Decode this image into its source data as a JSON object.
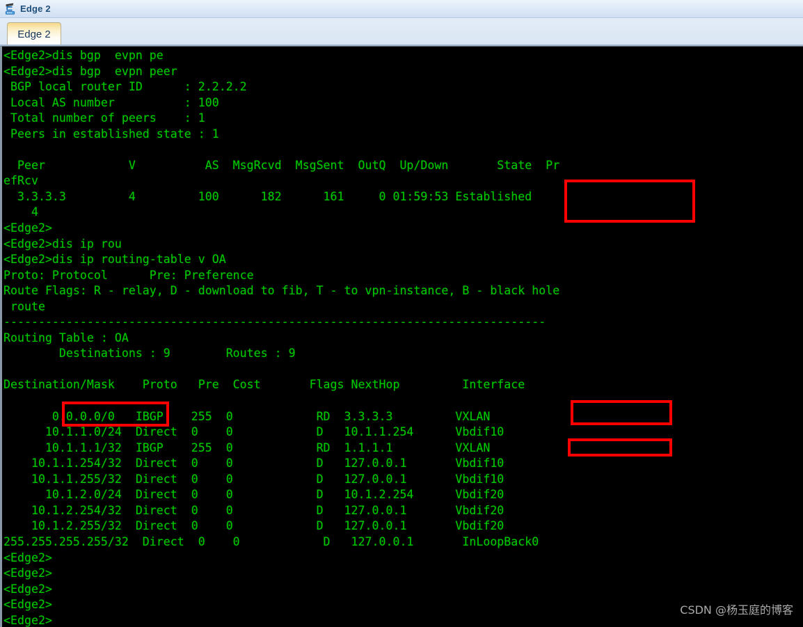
{
  "window": {
    "title": "Edge 2",
    "icon": "router-switch-icon"
  },
  "tabs": [
    {
      "label": "Edge 2",
      "active": true
    }
  ],
  "terminal": {
    "prompt": "<Edge2>",
    "foreground_color": "#00c800",
    "background_color": "#000000",
    "lines": [
      "<Edge2>dis bgp  evpn pe",
      "<Edge2>dis bgp  evpn peer",
      " BGP local router ID      : 2.2.2.2",
      " Local AS number          : 100",
      " Total number of peers    : 1",
      " Peers in established state : 1",
      "",
      "  Peer            V          AS  MsgRcvd  MsgSent  OutQ  Up/Down       State  Pr",
      "efRcv",
      "  3.3.3.3         4         100      182      161     0 01:59:53 Established",
      "    4",
      "<Edge2>",
      "<Edge2>dis ip rou",
      "<Edge2>dis ip routing-table v OA",
      "Proto: Protocol      Pre: Preference",
      "Route Flags: R - relay, D - download to fib, T - to vpn-instance, B - black hole",
      " route",
      "------------------------------------------------------------------------------",
      "Routing Table : OA",
      "        Destinations : 9        Routes : 9",
      "",
      "Destination/Mask    Proto   Pre  Cost       Flags NextHop         Interface",
      "",
      "       0.0.0.0/0   IBGP    255  0            RD  3.3.3.3         VXLAN",
      "      10.1.1.0/24  Direct  0    0            D   10.1.1.254      Vbdif10",
      "      10.1.1.1/32  IBGP    255  0            RD  1.1.1.1         VXLAN",
      "    10.1.1.254/32  Direct  0    0            D   127.0.0.1       Vbdif10",
      "    10.1.1.255/32  Direct  0    0            D   127.0.0.1       Vbdif10",
      "      10.1.2.0/24  Direct  0    0            D   10.1.2.254      Vbdif20",
      "    10.1.2.254/32  Direct  0    0            D   127.0.0.1       Vbdif20",
      "    10.1.2.255/32  Direct  0    0            D   127.0.0.1       Vbdif20",
      "255.255.255.255/32  Direct  0    0            D   127.0.0.1       InLoopBack0",
      "<Edge2>",
      "<Edge2>",
      "<Edge2>",
      "<Edge2>",
      "<Edge2>"
    ]
  },
  "bgp_summary": {
    "command": "dis bgp  evpn peer",
    "local_router_id_label": "BGP local router ID",
    "local_router_id": "2.2.2.2",
    "local_as_label": "Local AS number",
    "local_as": "100",
    "total_peers_label": "Total number of peers",
    "total_peers": "1",
    "established_peers_label": "Peers in established state",
    "established_peers": "1",
    "columns": [
      "Peer",
      "V",
      "AS",
      "MsgRcvd",
      "MsgSent",
      "OutQ",
      "Up/Down",
      "State",
      "PrefRcv"
    ],
    "rows": [
      {
        "peer": "3.3.3.3",
        "v": "4",
        "as": "100",
        "msg_rcvd": "182",
        "msg_sent": "161",
        "out_q": "0",
        "up_down": "01:59:53",
        "state": "Established",
        "pref_rcv": "4"
      }
    ]
  },
  "routing_table": {
    "command": "dis ip routing-table v OA",
    "proto_legend": "Proto: Protocol      Pre: Preference",
    "flags_legend": "Route Flags: R - relay, D - download to fib, T - to vpn-instance, B - black hole route",
    "table_name_label": "Routing Table :",
    "table_name": "OA",
    "destinations_label": "Destinations :",
    "destinations": "9",
    "routes_label": "Routes :",
    "routes": "9",
    "columns": [
      "Destination/Mask",
      "Proto",
      "Pre",
      "Cost",
      "Flags",
      "NextHop",
      "Interface"
    ],
    "rows": [
      {
        "destination": "0.0.0.0/0",
        "proto": "IBGP",
        "pre": "255",
        "cost": "0",
        "flags": "RD",
        "nexthop": "3.3.3.3",
        "interface": "VXLAN"
      },
      {
        "destination": "10.1.1.0/24",
        "proto": "Direct",
        "pre": "0",
        "cost": "0",
        "flags": "D",
        "nexthop": "10.1.1.254",
        "interface": "Vbdif10"
      },
      {
        "destination": "10.1.1.1/32",
        "proto": "IBGP",
        "pre": "255",
        "cost": "0",
        "flags": "RD",
        "nexthop": "1.1.1.1",
        "interface": "VXLAN"
      },
      {
        "destination": "10.1.1.254/32",
        "proto": "Direct",
        "pre": "0",
        "cost": "0",
        "flags": "D",
        "nexthop": "127.0.0.1",
        "interface": "Vbdif10"
      },
      {
        "destination": "10.1.1.255/32",
        "proto": "Direct",
        "pre": "0",
        "cost": "0",
        "flags": "D",
        "nexthop": "127.0.0.1",
        "interface": "Vbdif10"
      },
      {
        "destination": "10.1.2.0/24",
        "proto": "Direct",
        "pre": "0",
        "cost": "0",
        "flags": "D",
        "nexthop": "10.1.2.254",
        "interface": "Vbdif20"
      },
      {
        "destination": "10.1.2.254/32",
        "proto": "Direct",
        "pre": "0",
        "cost": "0",
        "flags": "D",
        "nexthop": "127.0.0.1",
        "interface": "Vbdif20"
      },
      {
        "destination": "10.1.2.255/32",
        "proto": "Direct",
        "pre": "0",
        "cost": "0",
        "flags": "D",
        "nexthop": "127.0.0.1",
        "interface": "Vbdif20"
      },
      {
        "destination": "255.255.255.255/32",
        "proto": "Direct",
        "pre": "0",
        "cost": "0",
        "flags": "D",
        "nexthop": "127.0.0.1",
        "interface": "InLoopBack0"
      }
    ]
  },
  "annotations": {
    "color": "#ff0000",
    "boxes": [
      {
        "name": "established-state",
        "text": "Established"
      },
      {
        "name": "default-route-destination",
        "text": "0.0.0.0/0"
      },
      {
        "name": "default-route-interface",
        "text": "VXLAN"
      },
      {
        "name": "host-route-interface",
        "text": "VXLAN"
      }
    ]
  },
  "watermark": {
    "text": "CSDN @杨玉庭的博客"
  }
}
